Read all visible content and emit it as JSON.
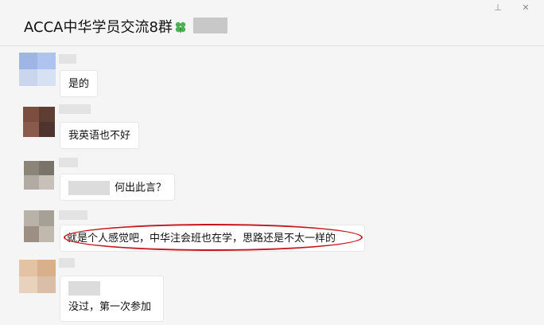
{
  "header": {
    "title": "ACCA中华学员交流8群",
    "title_emoji": "clover-icon",
    "pin_icon": "pin-icon",
    "close_icon": "close-icon"
  },
  "messages": [
    {
      "text": "是的",
      "avatar_colors": [
        "#9fb5e6",
        "#aec3ef",
        "#c9d6ee",
        "#d7e1f4"
      ]
    },
    {
      "text": "我英语也不好",
      "avatar_colors": [
        "#6b4a40",
        "#5a3a32",
        "#7a5248",
        "#4e342c"
      ]
    },
    {
      "text": "何出此言？",
      "avatar_colors": [
        "#8d8479",
        "#a39b91",
        "#b1aba4",
        "#c7c1ba"
      ]
    },
    {
      "text": "就是个人感觉吧，中华注会班也在学，思路还是不太一样的",
      "avatar_colors": [
        "#b9b2a9",
        "#a7a097",
        "#9e8f85",
        "#c1b8ae"
      ]
    },
    {
      "text": "没过，第一次参加",
      "avatar_colors": [
        "#e3c3a4",
        "#d8b08c",
        "#e9d2bd",
        "#d9bfa8"
      ]
    }
  ],
  "colors": {
    "background": "#f5f5f5",
    "bubble": "#ffffff",
    "highlight": "#c4161c"
  }
}
